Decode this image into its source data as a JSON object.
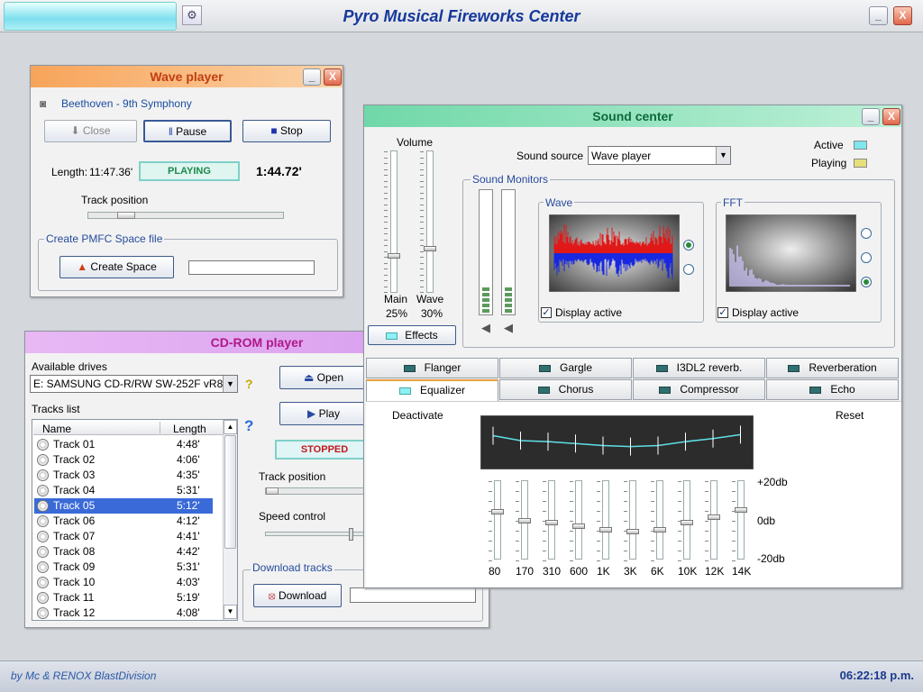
{
  "app": {
    "title": "Pyro Musical Fireworks Center",
    "minimize": "_",
    "close": "X"
  },
  "statusbar": {
    "credit": "by Mc & RENOX BlastDivision",
    "clock": "06:22:18 p.m."
  },
  "wave_player": {
    "title": "Wave player",
    "song": "Beethoven - 9th Symphony",
    "close_label": "Close",
    "pause_label": "Pause",
    "stop_label": "Stop",
    "length_label": "Length:",
    "length_value": "11:47.36'",
    "status": "PLAYING",
    "elapsed": "1:44.72'",
    "track_position_label": "Track position",
    "track_position": 0.16,
    "space_group_label": "Create PMFC Space file",
    "create_space_label": "Create Space",
    "space_value": ""
  },
  "cdrom": {
    "title": "CD-ROM player",
    "drives_label": "Available drives",
    "drive_selected": "E: SAMSUNG CD-R/RW SW-252F vR802",
    "tracks_label": "Tracks list",
    "col_name": "Name",
    "col_length": "Length",
    "tracks": [
      {
        "name": "Track 01",
        "length": "4:48'"
      },
      {
        "name": "Track 02",
        "length": "4:06'"
      },
      {
        "name": "Track 03",
        "length": "4:35'"
      },
      {
        "name": "Track 04",
        "length": "5:31'"
      },
      {
        "name": "Track 05",
        "length": "5:12'"
      },
      {
        "name": "Track 06",
        "length": "4:12'"
      },
      {
        "name": "Track 07",
        "length": "4:41'"
      },
      {
        "name": "Track 08",
        "length": "4:42'"
      },
      {
        "name": "Track 09",
        "length": "5:31'"
      },
      {
        "name": "Track 10",
        "length": "4:03'"
      },
      {
        "name": "Track 11",
        "length": "5:19'"
      },
      {
        "name": "Track 12",
        "length": "4:08'"
      }
    ],
    "selected_track": 4,
    "open_label": "Open",
    "play_label": "Play",
    "status": "STOPPED",
    "track_position_label": "Track position",
    "speed_label": "Speed control",
    "download_group_label": "Download tracks",
    "download_label": "Download",
    "download_value": ""
  },
  "sound_center": {
    "title": "Sound center",
    "volume_label": "Volume",
    "main_label": "Main",
    "main_value": "25%",
    "main_level": 0.25,
    "wave_vol_label": "Wave",
    "wave_vol_value": "30%",
    "wave_level": 0.3,
    "effects_label": "Effects",
    "source_label": "Sound source",
    "source_selected": "Wave player",
    "active_label": "Active",
    "playing_label": "Playing",
    "active_color": "#7fe6ee",
    "playing_color": "#e6e07a",
    "monitors_label": "Sound Monitors",
    "wave_label": "Wave",
    "fft_label": "FFT",
    "display_active_label": "Display active",
    "tabs_row1": [
      "Flanger",
      "Gargle",
      "I3DL2 reverb.",
      "Reverberation"
    ],
    "tabs_row2": [
      "Equalizer",
      "Chorus",
      "Compressor",
      "Echo"
    ],
    "active_tab": "Equalizer",
    "deactivate_label": "Deactivate",
    "reset_label": "Reset",
    "db_top": "+20db",
    "db_mid": "0db",
    "db_bottom": "-20db",
    "bands": [
      "80",
      "170",
      "310",
      "600",
      "1K",
      "3K",
      "6K",
      "10K",
      "12K",
      "14K"
    ],
    "band_db": [
      5,
      0,
      -1,
      -3,
      -5,
      -6,
      -5,
      -1,
      2,
      6
    ]
  }
}
